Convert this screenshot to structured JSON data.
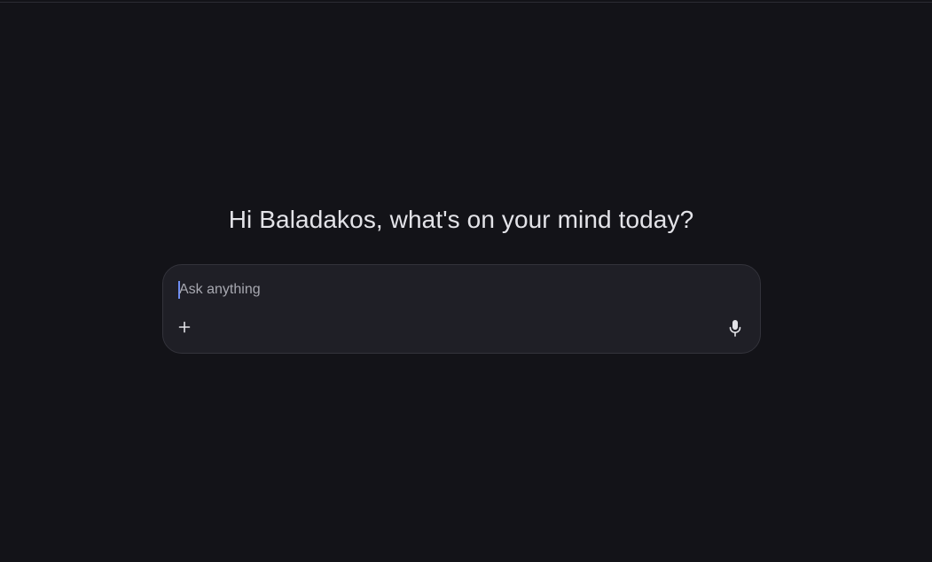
{
  "greeting": {
    "text": "Hi Baladakos, what's on your mind today?"
  },
  "composer": {
    "placeholder": "Ask anything",
    "value": "",
    "add_icon": "plus-icon",
    "mic_icon": "microphone-icon"
  },
  "colors": {
    "background": "#131318",
    "composer_bg": "#1f1f26",
    "text": "#e3e3e8",
    "placeholder": "#a7a8b0",
    "caret": "#6d8cf0"
  }
}
